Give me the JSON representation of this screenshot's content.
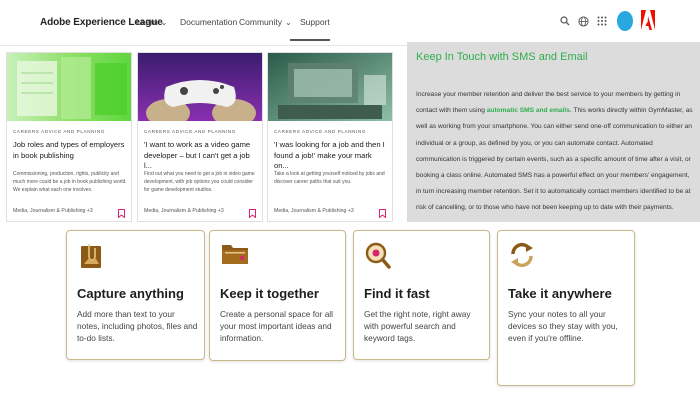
{
  "header": {
    "brand": "Adobe Experience League",
    "nav": [
      {
        "label": "Learn",
        "chevron": "⌄"
      },
      {
        "label": "Documentation"
      },
      {
        "label": "Community",
        "chevron": "⌄"
      },
      {
        "label": "Support"
      }
    ],
    "icons": [
      "search-icon",
      "globe-icon",
      "apps-grid-icon",
      "avatar",
      "adobe-logo-icon"
    ]
  },
  "cards": [
    {
      "category": "CAREERS ADVICE AND PLANNING",
      "title": "Job roles and types of employers in book publishing",
      "excerpt": "Commissioning, production, rights, publicity and much more could be a job in book publishing world. We explain what each one involves.",
      "meta": "Media, Journalism & Publishing +3"
    },
    {
      "category": "CAREERS ADVICE AND PLANNING",
      "title": "'I want to work as a video game developer – but I can't get a job l...",
      "excerpt": "Find out what you need to get a job in video game development, with job options you could consider for game development studios.",
      "meta": "Media, Journalism & Publishing +3"
    },
    {
      "category": "CAREERS ADVICE AND PLANNING",
      "title": "'I was looking for a job and then I found a job!' make your mark on...",
      "excerpt": "Take a look at getting yourself noticed by jobs and discover career paths that suit you.",
      "meta": "Media, Journalism & Publishing +3"
    }
  ],
  "sms": {
    "heading": "Keep In Touch with SMS and Email",
    "body_before": "Increase your member retention and deliver the best service to your members by getting in contact with them using ",
    "body_link": "automatic SMS and emails",
    "body_after": ". This works directly within GymMaster, as well as working from your smartphone. You can either send one-off communication to either an individual or a group, as defined by you, or you can automate contact. Automated communication is triggered by certain events, such as a specific amount of time after a visit, or booking a class online. Automated SMS has a powerful effect on your members' engagement, in turn increasing member retention. Set it to automatically contact members identified to be at risk of cancelling, or to those who have not been keeping up to date with their payments."
  },
  "features": [
    {
      "icon": "paperclip-note-icon",
      "title": "Capture anything",
      "desc": "Add more than text to your notes, including photos, files and to-do lists."
    },
    {
      "icon": "folder-icon",
      "title": "Keep it together",
      "desc": "Create a personal space for all your most important ideas and information."
    },
    {
      "icon": "magnifier-icon",
      "title": "Find it fast",
      "desc": "Get the right note, right away with powerful search and keyword tags."
    },
    {
      "icon": "sync-icon",
      "title": "Take it anywhere",
      "desc": "Sync your notes to all your devices so they stay with you, even if you're offline."
    }
  ],
  "colors": {
    "accent_green": "#2fae4e",
    "bookmark_pink": "#d6246e",
    "feature_icon_brown": "#8b5a16",
    "avatar_blue": "#29a8e0",
    "adobe_red": "#eb1000"
  }
}
